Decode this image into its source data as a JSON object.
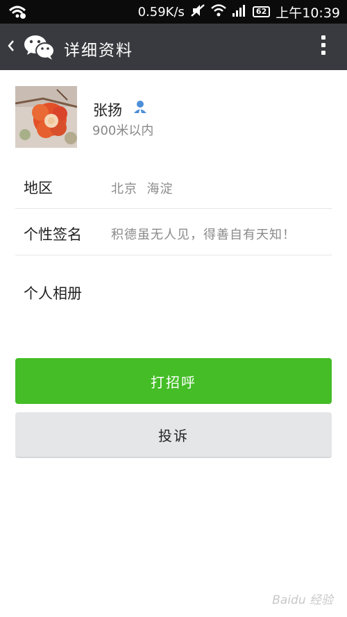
{
  "status_bar": {
    "speed": "0.59K/s",
    "battery": "62",
    "time": "上午10:39"
  },
  "action_bar": {
    "title": "详细资料"
  },
  "profile": {
    "name": "张扬",
    "distance": "900米以内"
  },
  "details": {
    "region_label": "地区",
    "region_value": "北京  海淀",
    "signature_label": "个性签名",
    "signature_value": "积德虽无人见，得善自有天知！",
    "album_label": "个人相册"
  },
  "buttons": {
    "greet": "打招呼",
    "report": "投诉"
  },
  "watermark": "Baidu 经验",
  "colors": {
    "action_bar": "#393a3f",
    "primary_button": "#44bd26",
    "secondary_button": "#e4e6e8"
  }
}
